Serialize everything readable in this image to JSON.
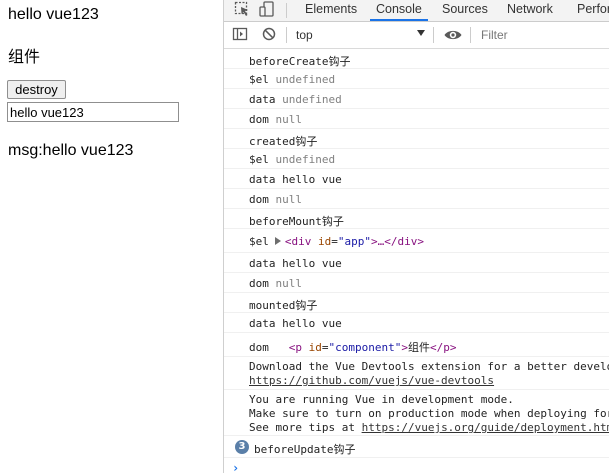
{
  "page": {
    "heading": "hello vue123",
    "component_text": "组件",
    "destroy_label": "destroy",
    "input_value": "hello vue123",
    "msg_line": "msg:hello vue123"
  },
  "devtools": {
    "tabs": [
      "Elements",
      "Console",
      "Sources",
      "Network",
      "Perfor"
    ],
    "active_tab": "Console",
    "context": "top",
    "filter_placeholder": "Filter",
    "accent_color": "#1a73e8",
    "icons": [
      "inspect-element-icon",
      "device-toolbar-icon",
      "sidebar-toggle-icon",
      "clear-console-icon",
      "eye-icon"
    ]
  },
  "console": {
    "r1": "beforeCreate钩子",
    "r2_key": "$el",
    "r2_val": "undefined",
    "r3_key": "data",
    "r3_val": "undefined",
    "r4_key": "dom",
    "r4_val": "null",
    "r5": "created钩子",
    "r6_key": "$el",
    "r6_val": "undefined",
    "r7": "data hello vue",
    "r8_key": "dom",
    "r8_val": "null",
    "r9": "beforeMount钩子",
    "r10_key": "$el",
    "r10_tag_open": "<div",
    "r10_attr": "id",
    "r10_attr_val": "\"app\"",
    "r10_rest": ">…</div>",
    "r11": "data hello vue",
    "r12_key": "dom",
    "r12_val": "null",
    "r13": "mounted钩子",
    "r14": "data hello vue",
    "r15_key": "dom",
    "r15_tag_open": "<p",
    "r15_attr": "id",
    "r15_attr_val": "\"component\"",
    "r15_tag_close": ">",
    "r15_text": "组件",
    "r15_end": "</p>",
    "r16_line1": "Download the Vue Devtools extension for a better develo",
    "r16_link": "https://github.com/vuejs/vue-devtools",
    "r17_line1": "You are running Vue in development mode.",
    "r17_line2": "Make sure to turn on production mode when deploying for",
    "r17_line3_prefix": "See more tips at ",
    "r17_link": "https://vuejs.org/guide/deployment.htm",
    "r18_count": "3",
    "r18": "beforeUpdate钩子",
    "prompt": "›"
  }
}
